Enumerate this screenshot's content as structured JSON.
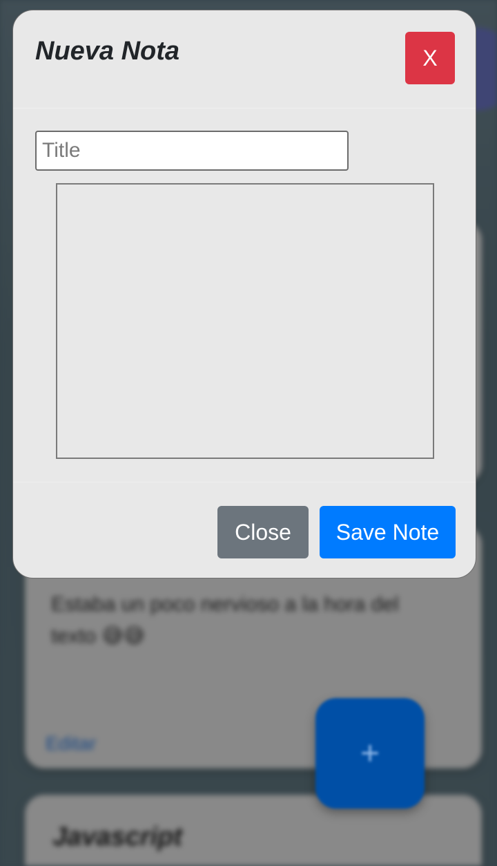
{
  "background": {
    "card_a": {},
    "card_b": {
      "text": "Estaba un poco nervioso a la hora del texto 😅😅",
      "link": "Editar"
    },
    "card_c": {
      "title": "Javascript"
    },
    "fab": {
      "label": "+"
    }
  },
  "modal": {
    "title": "Nueva Nota",
    "close_x_label": "X",
    "title_input": {
      "value": "",
      "placeholder": "Title"
    },
    "body_textarea": {
      "value": ""
    },
    "footer": {
      "close_label": "Close",
      "save_label": "Save Note"
    }
  },
  "colors": {
    "danger": "#dc3545",
    "secondary": "#6c757d",
    "primary": "#007bff",
    "fab": "#004fa6"
  }
}
